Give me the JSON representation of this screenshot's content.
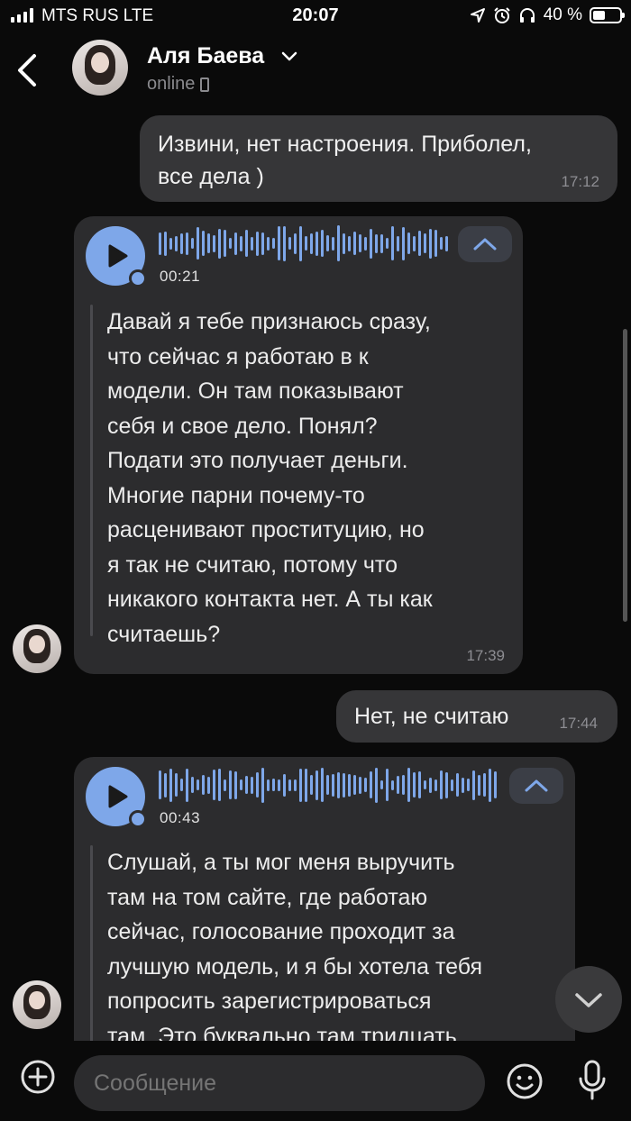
{
  "status_bar": {
    "carrier": "MTS RUS  LTE",
    "time": "20:07",
    "battery": "40 %"
  },
  "header": {
    "name": "Аля Баева",
    "status": "online"
  },
  "messages": [
    {
      "type": "out",
      "text_line1": "Извини, нет настроения. Приболел,",
      "text_line2": "все дела )",
      "time": "17:12"
    },
    {
      "type": "voice",
      "duration": "00:21",
      "time": "17:39",
      "transcript": [
        "Давай я тебе признаюсь сразу,",
        "что сейчас я работаю в к",
        "модели. Он там показывают",
        "себя и свое дело. Понял?",
        "Подати это получает деньги.",
        "Многие парни почему-то",
        "расценивают проституцию, но",
        "я так не считаю, потому что",
        "никакого контакта нет. А ты как",
        "считаешь?"
      ]
    },
    {
      "type": "out",
      "text": "Нет, не считаю",
      "time": "17:44"
    },
    {
      "type": "voice",
      "duration": "00:43",
      "transcript": [
        "Слушай, а ты мог меня выручить",
        "там на том сайте, где работаю",
        "сейчас, голосование проходит за",
        "лучшую модель, и я бы хотела тебя",
        "попросить зарегистрироваться",
        "там. Это буквально там тридцать"
      ]
    }
  ],
  "composer": {
    "placeholder": "Сообщение"
  },
  "colors": {
    "accent": "#7ea7e9",
    "background": "#0a0a0a",
    "bubble": "#2c2c2e"
  }
}
